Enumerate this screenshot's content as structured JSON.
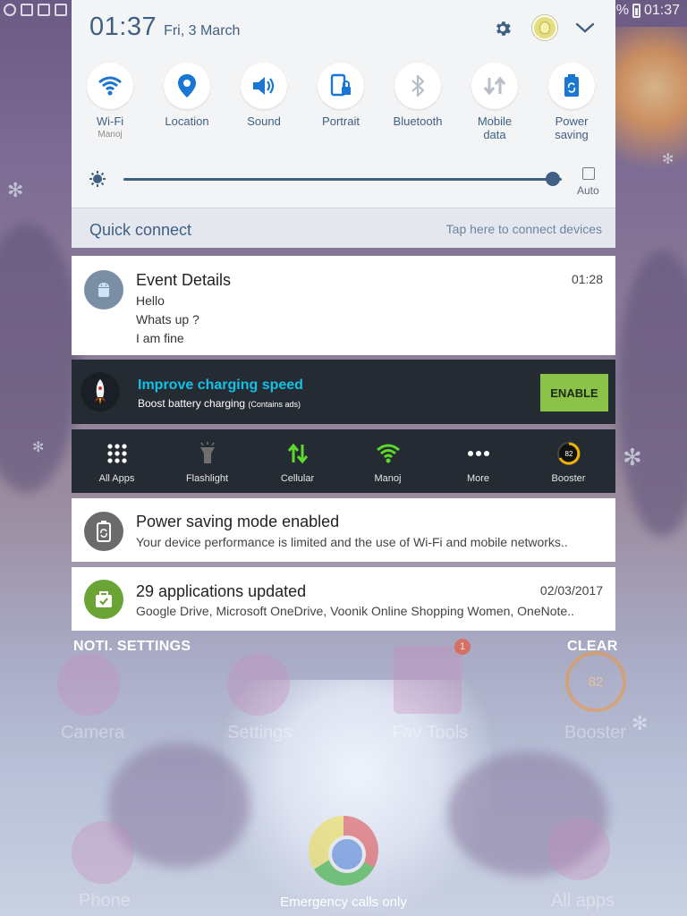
{
  "status_bar": {
    "time": "01:37",
    "battery_text": "%"
  },
  "shade": {
    "clock": "01:37",
    "date": "Fri, 3 March",
    "toggles": [
      {
        "label": "Wi-Fi",
        "sub": "Manoj",
        "icon": "wifi-icon",
        "active": true
      },
      {
        "label": "Location",
        "sub": "",
        "icon": "location-icon",
        "active": true
      },
      {
        "label": "Sound",
        "sub": "",
        "icon": "sound-icon",
        "active": true
      },
      {
        "label": "Portrait",
        "sub": "",
        "icon": "portrait-lock-icon",
        "active": true
      },
      {
        "label": "Bluetooth",
        "sub": "",
        "icon": "bluetooth-icon",
        "active": false
      },
      {
        "label": "Mobile\ndata",
        "sub": "",
        "icon": "mobile-data-icon",
        "active": false
      },
      {
        "label": "Power\nsaving",
        "sub": "",
        "icon": "power-saving-icon",
        "active": true
      }
    ],
    "brightness": {
      "level": 0.98,
      "auto_label": "Auto"
    }
  },
  "quick_connect": {
    "title": "Quick connect",
    "hint": "Tap here to connect devices"
  },
  "event": {
    "title": "Event Details",
    "time": "01:28",
    "lines": [
      "Hello",
      "Whats up ?",
      "I am fine"
    ]
  },
  "promo": {
    "title": "Improve charging speed",
    "subtitle": "Boost battery charging",
    "ads_note": "(Contains ads)",
    "button": "ENABLE"
  },
  "toolbar": [
    {
      "label": "All Apps",
      "icon": "grid-icon"
    },
    {
      "label": "Flashlight",
      "icon": "flashlight-icon"
    },
    {
      "label": "Cellular",
      "icon": "cellular-arrows-icon"
    },
    {
      "label": "Manoj",
      "icon": "wifi-icon"
    },
    {
      "label": "More",
      "icon": "more-dots-icon"
    },
    {
      "label": "Booster",
      "icon": "booster-gauge-icon",
      "value": "82"
    }
  ],
  "power_saving": {
    "title": "Power saving mode enabled",
    "text": "Your device performance is limited and the use of Wi-Fi and mobile networks.."
  },
  "apps_updated": {
    "title": "29 applications updated",
    "date": "02/03/2017",
    "text": "Google Drive, Microsoft OneDrive, Voonik Online Shopping Women, OneNote.."
  },
  "footer": {
    "left": "NOTI. SETTINGS",
    "right": "CLEAR",
    "emergency": "Emergency calls only"
  },
  "home_screen": {
    "labels": [
      "Camera",
      "Settings",
      "Fav Tools",
      "Booster",
      "Phone",
      "All apps"
    ],
    "booster_value": "82",
    "fav_badge": "1"
  },
  "colors": {
    "accent": "#3f5f83",
    "promo_title": "#12c1e6",
    "enable_btn": "#8bc34a",
    "dark_panel": "#252b33"
  }
}
